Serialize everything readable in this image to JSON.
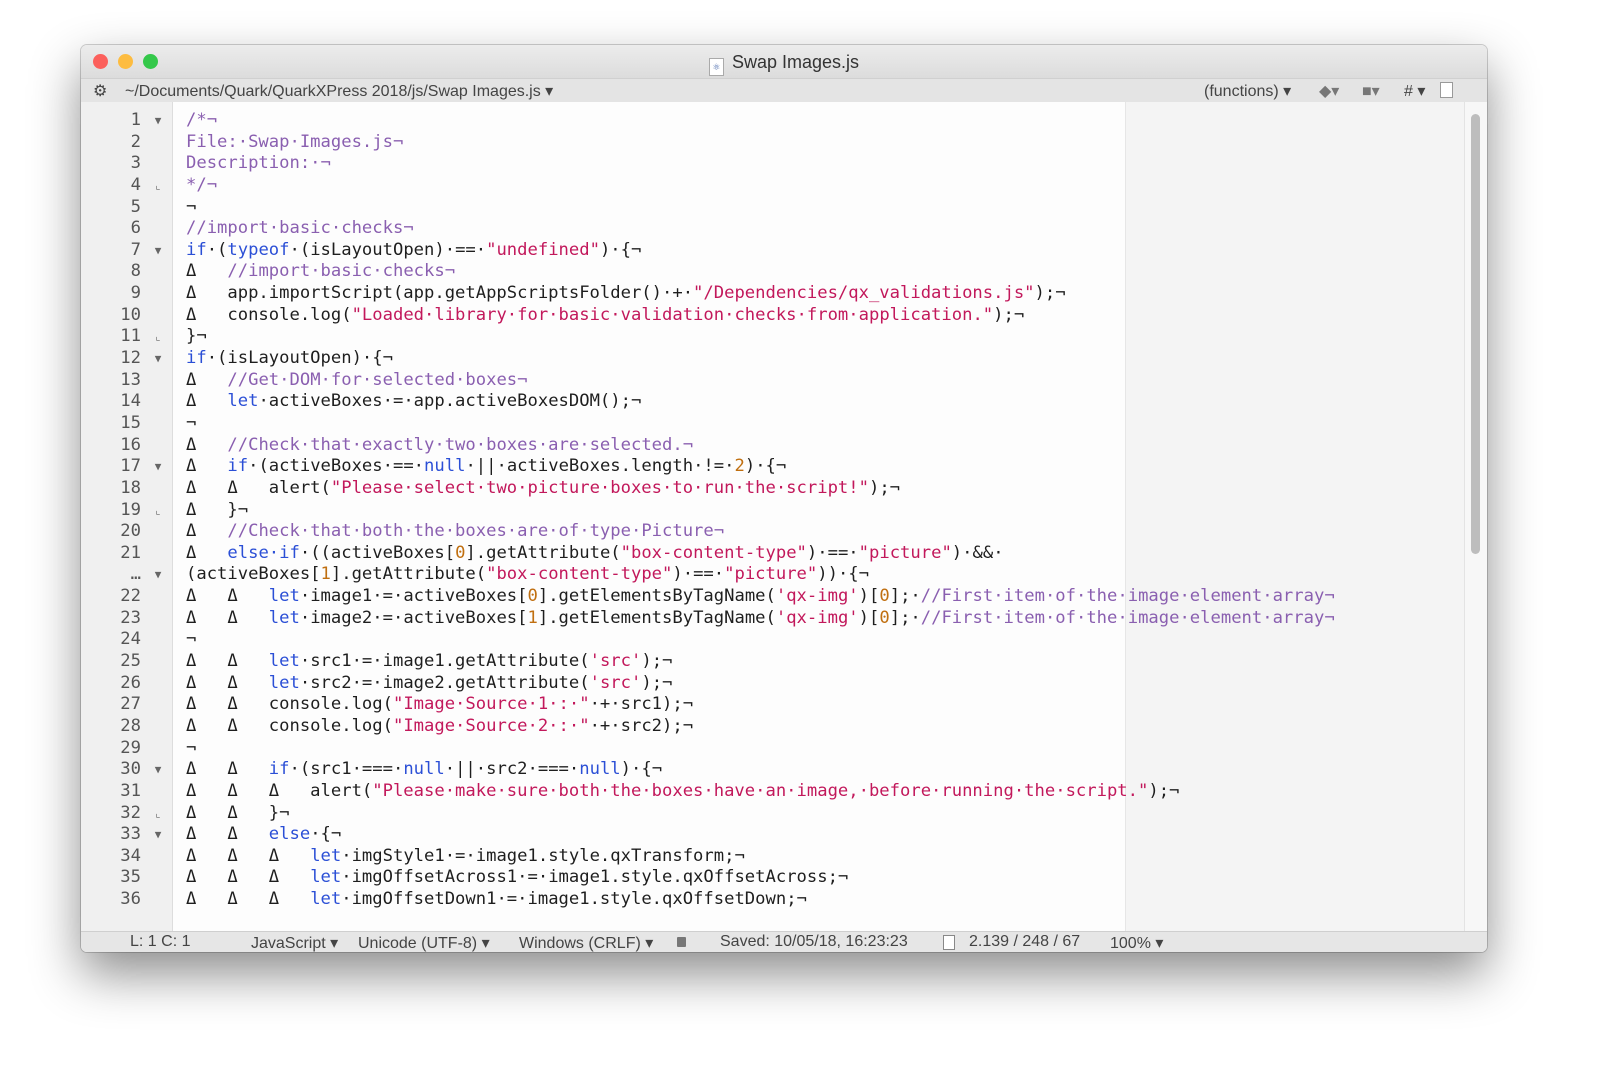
{
  "window": {
    "title": "Swap Images.js",
    "colors": {
      "close": "#fc605c",
      "minimize": "#fdbc40",
      "zoom": "#34c84a"
    }
  },
  "toolbar": {
    "path": "~/Documents/Quark/QuarkXPress 2018/js/Swap Images.js ▾",
    "functions": "(functions) ▾",
    "marker": "◆▾",
    "bookmark": "■▾",
    "hash": "# ▾"
  },
  "status": {
    "position": "L: 1 C: 1",
    "language": "JavaScript ▾",
    "encoding": "Unicode (UTF-8) ▾",
    "line_endings": "Windows (CRLF) ▾",
    "saved": "Saved: 10/05/18, 16:23:23",
    "counts": "2.139 / 248 / 67",
    "zoom": "100% ▾"
  },
  "lines": [
    {
      "n": "1",
      "f": "▼",
      "t": [
        [
          "c",
          "/*¬"
        ]
      ]
    },
    {
      "n": "2",
      "f": "",
      "t": [
        [
          "c",
          "File:·Swap·Images.js¬"
        ]
      ]
    },
    {
      "n": "3",
      "f": "",
      "t": [
        [
          "c",
          "Description:·¬"
        ]
      ]
    },
    {
      "n": "4",
      "f": "⌞",
      "t": [
        [
          "c",
          "*/¬"
        ]
      ]
    },
    {
      "n": "5",
      "f": "",
      "t": [
        [
          "p",
          "¬"
        ]
      ]
    },
    {
      "n": "6",
      "f": "",
      "t": [
        [
          "c",
          "//import·basic·checks¬"
        ]
      ]
    },
    {
      "n": "7",
      "f": "▼",
      "t": [
        [
          "k",
          "if"
        ],
        [
          "p",
          "·("
        ],
        [
          "k",
          "typeof"
        ],
        [
          "p",
          "·(isLayoutOpen)·==·"
        ],
        [
          "s",
          "\"undefined\""
        ],
        [
          "p",
          ")·{¬"
        ]
      ]
    },
    {
      "n": "8",
      "f": "",
      "t": [
        [
          "p",
          "Δ   "
        ],
        [
          "c",
          "//import·basic·checks¬"
        ]
      ]
    },
    {
      "n": "9",
      "f": "",
      "t": [
        [
          "p",
          "Δ   app.importScript(app.getAppScriptsFolder()·+·"
        ],
        [
          "s",
          "\"/Dependencies/qx_validations.js\""
        ],
        [
          "p",
          ");¬"
        ]
      ]
    },
    {
      "n": "10",
      "f": "",
      "t": [
        [
          "p",
          "Δ   console.log("
        ],
        [
          "s",
          "\"Loaded·library·for·basic·validation·checks·from·application.\""
        ],
        [
          "p",
          ");¬"
        ]
      ]
    },
    {
      "n": "11",
      "f": "⌞",
      "t": [
        [
          "p",
          "}¬"
        ]
      ]
    },
    {
      "n": "12",
      "f": "▼",
      "t": [
        [
          "k",
          "if"
        ],
        [
          "p",
          "·(isLayoutOpen)·{¬"
        ]
      ]
    },
    {
      "n": "13",
      "f": "",
      "t": [
        [
          "p",
          "Δ   "
        ],
        [
          "c",
          "//Get·DOM·for·selected·boxes¬"
        ]
      ]
    },
    {
      "n": "14",
      "f": "",
      "t": [
        [
          "p",
          "Δ   "
        ],
        [
          "k",
          "let"
        ],
        [
          "p",
          "·activeBoxes·=·app.activeBoxesDOM();¬"
        ]
      ]
    },
    {
      "n": "15",
      "f": "",
      "t": [
        [
          "p",
          "¬"
        ]
      ]
    },
    {
      "n": "16",
      "f": "",
      "t": [
        [
          "p",
          "Δ   "
        ],
        [
          "c",
          "//Check·that·exactly·two·boxes·are·selected.¬"
        ]
      ]
    },
    {
      "n": "17",
      "f": "▼",
      "t": [
        [
          "p",
          "Δ   "
        ],
        [
          "k",
          "if"
        ],
        [
          "p",
          "·(activeBoxes·==·"
        ],
        [
          "k",
          "null"
        ],
        [
          "p",
          "·||·activeBoxes.length·!=·"
        ],
        [
          "n",
          "2"
        ],
        [
          "p",
          ")·{¬"
        ]
      ]
    },
    {
      "n": "18",
      "f": "",
      "t": [
        [
          "p",
          "Δ   Δ   alert("
        ],
        [
          "s",
          "\"Please·select·two·picture·boxes·to·run·the·script!\""
        ],
        [
          "p",
          ");¬"
        ]
      ]
    },
    {
      "n": "19",
      "f": "⌞",
      "t": [
        [
          "p",
          "Δ   }¬"
        ]
      ]
    },
    {
      "n": "20",
      "f": "",
      "t": [
        [
          "p",
          "Δ   "
        ],
        [
          "c",
          "//Check·that·both·the·boxes·are·of·type·Picture¬"
        ]
      ]
    },
    {
      "n": "21",
      "f": "",
      "t": [
        [
          "p",
          "Δ   "
        ],
        [
          "k",
          "else·if"
        ],
        [
          "p",
          "·((activeBoxes["
        ],
        [
          "n",
          "0"
        ],
        [
          "p",
          "].getAttribute("
        ],
        [
          "s",
          "\"box-content-type\""
        ],
        [
          "p",
          ")·==·"
        ],
        [
          "s",
          "\"picture\""
        ],
        [
          "p",
          ")·&&·"
        ]
      ]
    },
    {
      "n": "…",
      "f": "▼",
      "t": [
        [
          "p",
          "(activeBoxes["
        ],
        [
          "n",
          "1"
        ],
        [
          "p",
          "].getAttribute("
        ],
        [
          "s",
          "\"box-content-type\""
        ],
        [
          "p",
          ")·==·"
        ],
        [
          "s",
          "\"picture\""
        ],
        [
          "p",
          "))·{¬"
        ]
      ]
    },
    {
      "n": "22",
      "f": "",
      "t": [
        [
          "p",
          "Δ   Δ   "
        ],
        [
          "k",
          "let"
        ],
        [
          "p",
          "·image1·=·activeBoxes["
        ],
        [
          "n",
          "0"
        ],
        [
          "p",
          "].getElementsByTagName("
        ],
        [
          "s",
          "'qx-img'"
        ],
        [
          "p",
          ")["
        ],
        [
          "n",
          "0"
        ],
        [
          "p",
          "];·"
        ],
        [
          "c",
          "//First·item·of·the·image·element·array¬"
        ]
      ]
    },
    {
      "n": "23",
      "f": "",
      "t": [
        [
          "p",
          "Δ   Δ   "
        ],
        [
          "k",
          "let"
        ],
        [
          "p",
          "·image2·=·activeBoxes["
        ],
        [
          "n",
          "1"
        ],
        [
          "p",
          "].getElementsByTagName("
        ],
        [
          "s",
          "'qx-img'"
        ],
        [
          "p",
          ")["
        ],
        [
          "n",
          "0"
        ],
        [
          "p",
          "];·"
        ],
        [
          "c",
          "//First·item·of·the·image·element·array¬"
        ]
      ]
    },
    {
      "n": "24",
      "f": "",
      "t": [
        [
          "p",
          "¬"
        ]
      ]
    },
    {
      "n": "25",
      "f": "",
      "t": [
        [
          "p",
          "Δ   Δ   "
        ],
        [
          "k",
          "let"
        ],
        [
          "p",
          "·src1·=·image1.getAttribute("
        ],
        [
          "s",
          "'src'"
        ],
        [
          "p",
          ");¬"
        ]
      ]
    },
    {
      "n": "26",
      "f": "",
      "t": [
        [
          "p",
          "Δ   Δ   "
        ],
        [
          "k",
          "let"
        ],
        [
          "p",
          "·src2·=·image2.getAttribute("
        ],
        [
          "s",
          "'src'"
        ],
        [
          "p",
          ");¬"
        ]
      ]
    },
    {
      "n": "27",
      "f": "",
      "t": [
        [
          "p",
          "Δ   Δ   console.log("
        ],
        [
          "s",
          "\"Image·Source·1·:·\""
        ],
        [
          "p",
          "·+·src1);¬"
        ]
      ]
    },
    {
      "n": "28",
      "f": "",
      "t": [
        [
          "p",
          "Δ   Δ   console.log("
        ],
        [
          "s",
          "\"Image·Source·2·:·\""
        ],
        [
          "p",
          "·+·src2);¬"
        ]
      ]
    },
    {
      "n": "29",
      "f": "",
      "t": [
        [
          "p",
          "¬"
        ]
      ]
    },
    {
      "n": "30",
      "f": "▼",
      "t": [
        [
          "p",
          "Δ   Δ   "
        ],
        [
          "k",
          "if"
        ],
        [
          "p",
          "·(src1·===·"
        ],
        [
          "k",
          "null"
        ],
        [
          "p",
          "·||·src2·===·"
        ],
        [
          "k",
          "null"
        ],
        [
          "p",
          ")·{¬"
        ]
      ]
    },
    {
      "n": "31",
      "f": "",
      "t": [
        [
          "p",
          "Δ   Δ   Δ   alert("
        ],
        [
          "s",
          "\"Please·make·sure·both·the·boxes·have·an·image,·before·running·the·script.\""
        ],
        [
          "p",
          ");¬"
        ]
      ]
    },
    {
      "n": "32",
      "f": "⌞",
      "t": [
        [
          "p",
          "Δ   Δ   }¬"
        ]
      ]
    },
    {
      "n": "33",
      "f": "▼",
      "t": [
        [
          "p",
          "Δ   Δ   "
        ],
        [
          "k",
          "else"
        ],
        [
          "p",
          "·{¬"
        ]
      ]
    },
    {
      "n": "34",
      "f": "",
      "t": [
        [
          "p",
          "Δ   Δ   Δ   "
        ],
        [
          "k",
          "let"
        ],
        [
          "p",
          "·imgStyle1·=·image1.style.qxTransform;¬"
        ]
      ]
    },
    {
      "n": "35",
      "f": "",
      "t": [
        [
          "p",
          "Δ   Δ   Δ   "
        ],
        [
          "k",
          "let"
        ],
        [
          "p",
          "·imgOffsetAcross1·=·image1.style.qxOffsetAcross;¬"
        ]
      ]
    },
    {
      "n": "36",
      "f": "",
      "t": [
        [
          "p",
          "Δ   Δ   Δ   "
        ],
        [
          "k",
          "let"
        ],
        [
          "p",
          "·imgOffsetDown1·=·image1.style.qxOffsetDown;¬"
        ]
      ]
    }
  ]
}
